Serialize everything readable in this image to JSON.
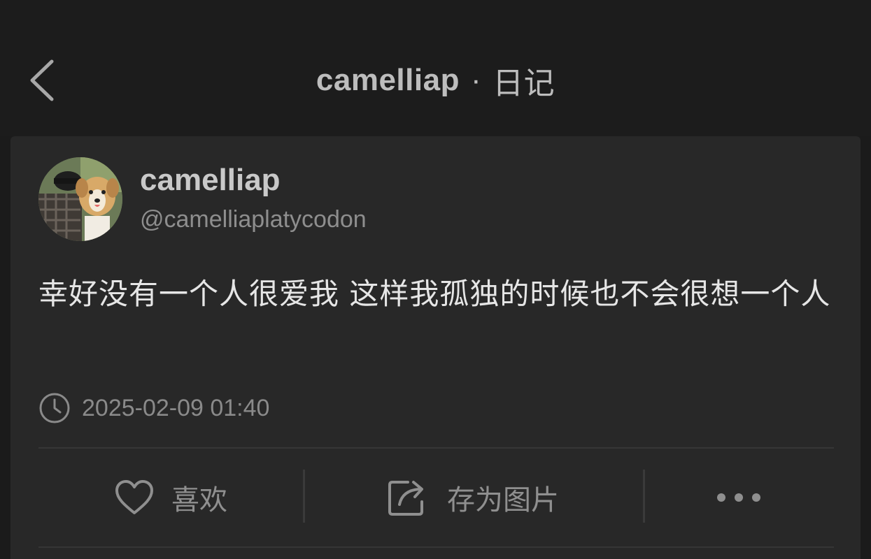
{
  "header": {
    "title": "camelliap",
    "separator": "·",
    "section": "日记",
    "back_icon": "chevron-left-icon"
  },
  "post": {
    "author": {
      "name": "camelliap",
      "handle": "@camelliaplatycodon"
    },
    "text": "幸好没有一个人很爱我 这样我孤独的时候也不会很想一个人",
    "timestamp": "2025-02-09 01:40"
  },
  "actions": {
    "like_label": "喜欢",
    "like_icon": "heart-icon",
    "save_label": "存为图片",
    "save_icon": "share-image-icon",
    "more_icon": "more-icon"
  },
  "colors": {
    "background": "#1b1b1b",
    "card": "#282828",
    "text_primary": "#e6e6e6",
    "text_secondary": "#8e8e8e"
  }
}
